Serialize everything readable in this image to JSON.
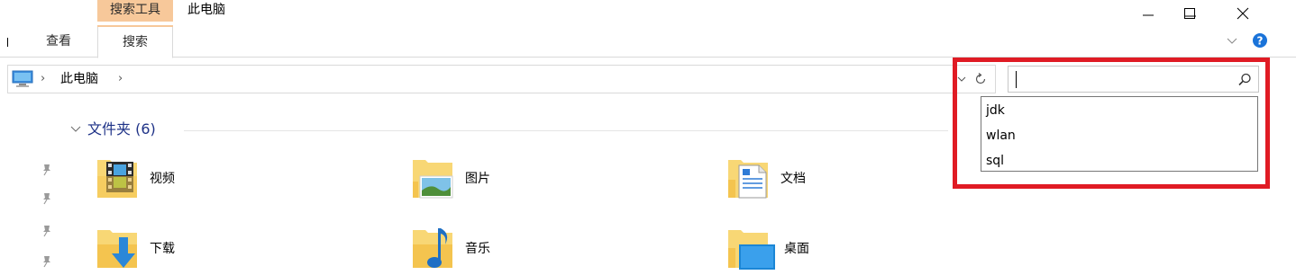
{
  "titlebar": {
    "context_tab": "搜索工具",
    "window_title": "此电脑",
    "buttons": [
      "minimize",
      "maximize",
      "close"
    ]
  },
  "ribbon": {
    "tabs": [
      {
        "label": "查看",
        "active": false
      },
      {
        "label": "搜索",
        "active": true
      }
    ],
    "help_icon": "question-icon",
    "collapse_icon": "chevron-down-icon"
  },
  "address": {
    "location_icon": "computer-icon",
    "crumbs": [
      "此电脑"
    ]
  },
  "search": {
    "value": "",
    "suggestions": [
      "jdk",
      "wlan",
      "sql"
    ]
  },
  "content": {
    "group_title": "文件夹 (6)",
    "folders": [
      {
        "name": "视频",
        "icon": "video-folder-icon"
      },
      {
        "name": "图片",
        "icon": "pictures-folder-icon"
      },
      {
        "name": "文档",
        "icon": "documents-folder-icon"
      },
      {
        "name": "下载",
        "icon": "downloads-folder-icon"
      },
      {
        "name": "音乐",
        "icon": "music-folder-icon"
      },
      {
        "name": "桌面",
        "icon": "desktop-folder-icon"
      }
    ]
  },
  "colors": {
    "context_tab": "#f7c89a",
    "highlight": "#e01b24",
    "group_header": "#1e3287",
    "folder_yellow": "#f8d775",
    "help_blue": "#1a73d9"
  }
}
